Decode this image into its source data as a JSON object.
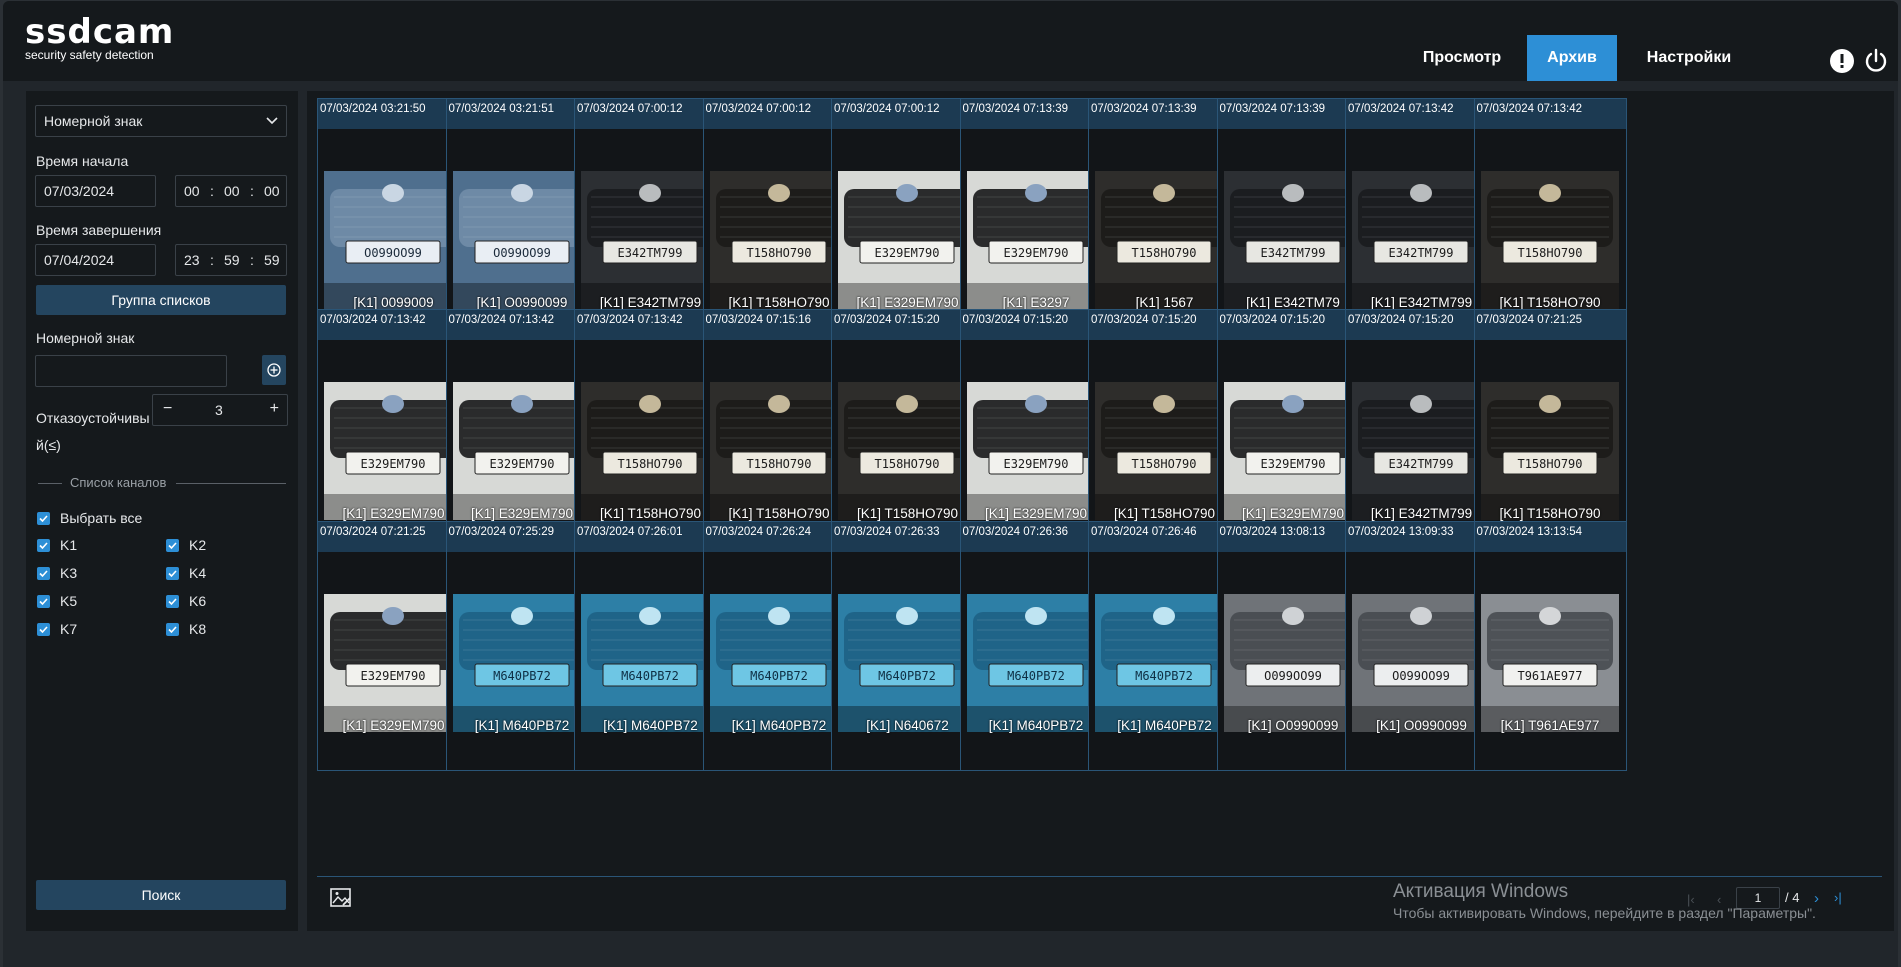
{
  "app": {
    "logo_text": "ssdcam",
    "logo_subtitle": "security safety detection"
  },
  "nav": {
    "items": [
      {
        "label": "Просмотр",
        "active": false
      },
      {
        "label": "Архив",
        "active": true
      },
      {
        "label": "Настройки",
        "active": false
      }
    ],
    "accent": "#2d8fd6"
  },
  "header_icons": [
    "alert-icon",
    "power-icon"
  ],
  "sidebar": {
    "search_type": "Номерной знак",
    "start_label": "Время начала",
    "start_date": "07/03/2024",
    "start_h": "00",
    "start_m": "00",
    "start_s": "00",
    "end_label": "Время завершения",
    "end_date": "07/04/2024",
    "end_h": "23",
    "end_m": "59",
    "end_s": "59",
    "list_group_button": "Группа списков",
    "plate_label": "Номерной знак",
    "plate_value": "",
    "tolerance_label_1": "Отказоустойчивы",
    "tolerance_label_2": "й(≤)",
    "tolerance_value": "3",
    "tolerance_minus": "−",
    "tolerance_plus": "+",
    "channel_list_title": "Список каналов",
    "select_all": "Выбрать все",
    "channels": [
      "K1",
      "K2",
      "K3",
      "K4",
      "K5",
      "K6",
      "K7",
      "K8"
    ],
    "search_button": "Поиск"
  },
  "results": [
    {
      "time": "07/03/2024 03:21:50",
      "label": "[K1] 0099009",
      "car": "toyota-blue"
    },
    {
      "time": "07/03/2024 03:21:51",
      "label": "[K1] O0990099",
      "car": "toyota-blue"
    },
    {
      "time": "07/03/2024 07:00:12",
      "label": "[K1] E342TM799",
      "car": "renault"
    },
    {
      "time": "07/03/2024 07:00:12",
      "label": "[K1] T158HO790",
      "car": "cadillac"
    },
    {
      "time": "07/03/2024 07:00:12",
      "label": "[K1] E329EM790",
      "car": "bmw"
    },
    {
      "time": "07/03/2024 07:13:39",
      "label": "[K1] E3297",
      "car": "bmw"
    },
    {
      "time": "07/03/2024 07:13:39",
      "label": "[K1] 1567",
      "car": "cadillac"
    },
    {
      "time": "07/03/2024 07:13:39",
      "label": "[K1] E342TM79",
      "car": "renault"
    },
    {
      "time": "07/03/2024 07:13:42",
      "label": "[K1] E342TM799",
      "car": "renault"
    },
    {
      "time": "07/03/2024 07:13:42",
      "label": "[K1] T158HO790",
      "car": "cadillac"
    },
    {
      "time": "07/03/2024 07:13:42",
      "label": "[K1] E329EM790",
      "car": "bmw"
    },
    {
      "time": "07/03/2024 07:13:42",
      "label": "[K1] E329EM790",
      "car": "bmw"
    },
    {
      "time": "07/03/2024 07:13:42",
      "label": "[K1] T158HO790",
      "car": "cadillac"
    },
    {
      "time": "07/03/2024 07:15:16",
      "label": "[K1] T158HO790",
      "car": "cadillac"
    },
    {
      "time": "07/03/2024 07:15:20",
      "label": "[K1] T158HO790",
      "car": "cadillac"
    },
    {
      "time": "07/03/2024 07:15:20",
      "label": "[K1] E329EM790",
      "car": "bmw"
    },
    {
      "time": "07/03/2024 07:15:20",
      "label": "[K1] T158HO790",
      "car": "cadillac"
    },
    {
      "time": "07/03/2024 07:15:20",
      "label": "[K1] E329EM790",
      "car": "bmw"
    },
    {
      "time": "07/03/2024 07:15:20",
      "label": "[K1] E342TM799",
      "car": "renault"
    },
    {
      "time": "07/03/2024 07:21:25",
      "label": "[K1] T158HO790",
      "car": "cadillac"
    },
    {
      "time": "07/03/2024 07:21:25",
      "label": "[K1] E329EM790",
      "car": "bmw"
    },
    {
      "time": "07/03/2024 07:25:29",
      "label": "[K1] M640PB72",
      "car": "peugeot"
    },
    {
      "time": "07/03/2024 07:26:01",
      "label": "[K1] M640PB72",
      "car": "peugeot"
    },
    {
      "time": "07/03/2024 07:26:24",
      "label": "[K1] M640PB72",
      "car": "peugeot"
    },
    {
      "time": "07/03/2024 07:26:33",
      "label": "[K1] N640672",
      "car": "peugeot"
    },
    {
      "time": "07/03/2024 07:26:36",
      "label": "[K1] M640PB72",
      "car": "peugeot"
    },
    {
      "time": "07/03/2024 07:26:46",
      "label": "[K1] M640PB72",
      "car": "peugeot"
    },
    {
      "time": "07/03/2024 13:08:13",
      "label": "[K1] O0990099",
      "car": "toyota-grey"
    },
    {
      "time": "07/03/2024 13:09:33",
      "label": "[K1] O0990099",
      "car": "toyota-grey"
    },
    {
      "time": "07/03/2024 13:13:54",
      "label": "[K1] T961AE977",
      "car": "nissan"
    }
  ],
  "plates": {
    "toyota-blue": "O099OO99",
    "toyota-grey": "O099OO99",
    "renault": "E342TM799",
    "cadillac": "T158HO790",
    "bmw": "E329EM790",
    "peugeot": "M640PB72",
    "nissan": "T961AE977"
  },
  "pager": {
    "page": "1",
    "total": "/ 4"
  },
  "watermark": {
    "title": "Активация Windows",
    "text": "Чтобы активировать Windows, перейдите в раздел \"Параметры\"."
  },
  "colors": {
    "accent": "#2d8fd6",
    "card_header": "#1c3a52",
    "card_border": "#2a5577",
    "panel": "#15191c"
  }
}
